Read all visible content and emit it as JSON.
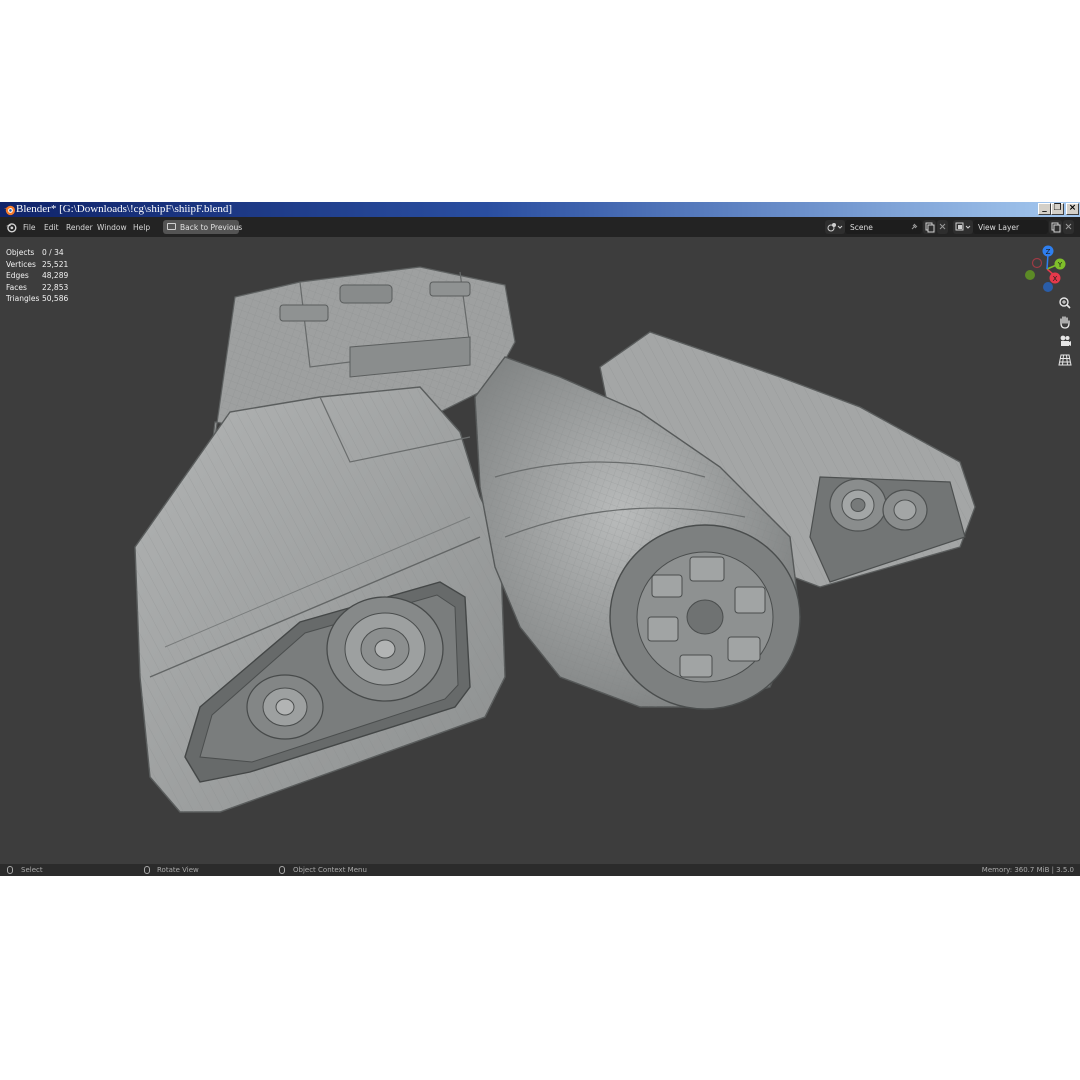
{
  "window": {
    "title": "Blender* [G:\\Downloads\\!cg\\shipF\\shiipF.blend]",
    "controls": [
      "_",
      "❐",
      "×"
    ]
  },
  "menubar": {
    "items": [
      "File",
      "Edit",
      "Render",
      "Window",
      "Help"
    ],
    "back_button": "Back to Previous",
    "scene": "Scene",
    "view_layer": "View Layer"
  },
  "stats": [
    {
      "label": "Objects",
      "value": "0 / 34"
    },
    {
      "label": "Vertices",
      "value": "25,521"
    },
    {
      "label": "Edges",
      "value": "48,289"
    },
    {
      "label": "Faces",
      "value": "22,853"
    },
    {
      "label": "Triangles",
      "value": "50,586"
    }
  ],
  "gizmo": {
    "x": "X",
    "y": "Y",
    "z": "Z"
  },
  "statusbar": {
    "select": "Select",
    "rotate": "Rotate View",
    "context": "Object Context Menu",
    "memory": "Memory: 360.7 MiB | 3.5.0"
  },
  "colors": {
    "viewport": "#3d3d3d",
    "axis_x": "#e5394b",
    "axis_y": "#7fbf2a",
    "axis_z": "#2e7ff0",
    "model": "#9a9c9c"
  }
}
